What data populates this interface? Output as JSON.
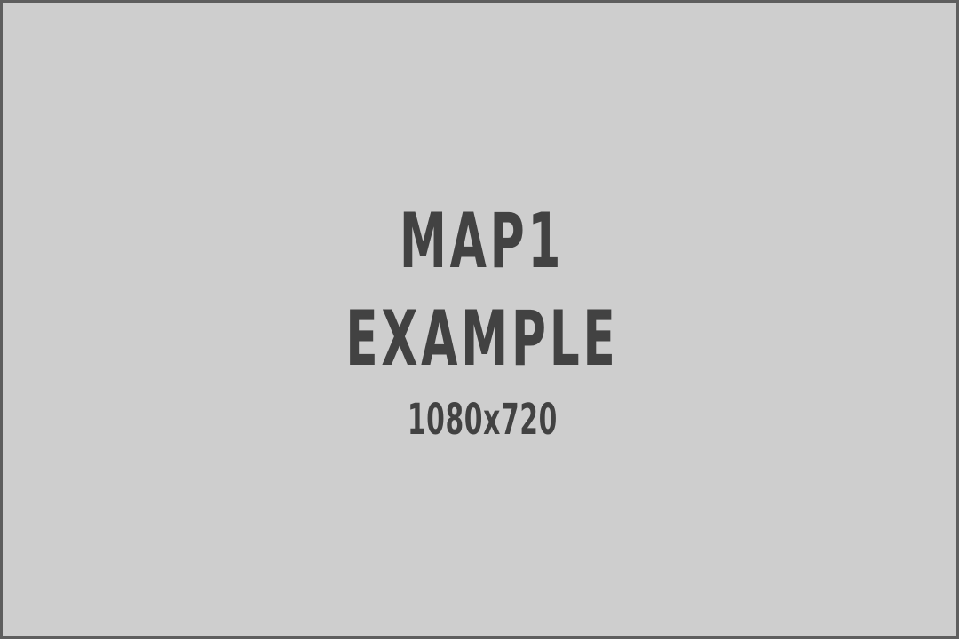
{
  "placeholder": {
    "line1": "MAP1",
    "line2": "EXAMPLE",
    "dimensions": "1080x720"
  },
  "colors": {
    "background": "#cecece",
    "border": "#5e5e5e",
    "text": "#424242"
  }
}
